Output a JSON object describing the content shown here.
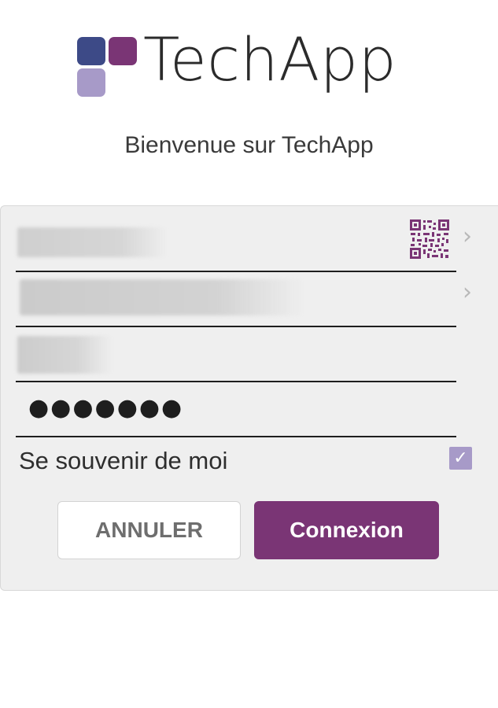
{
  "logo": {
    "text": "TechApp",
    "colors": [
      "#3d4a87",
      "#7a3575",
      "#a79ac8"
    ]
  },
  "welcome": "Bienvenue sur TechApp",
  "form": {
    "password_mask": "●●●●●●●",
    "remember_label": "Se souvenir de moi",
    "remember_checked": true,
    "checkbox_glyph": "✓",
    "chevron_glyph": "›",
    "qr_icon": "qr-code-icon"
  },
  "buttons": {
    "cancel": "ANNULER",
    "login": "Connexion"
  },
  "colors": {
    "accent": "#7a3575",
    "panel": "#efefef",
    "checkbox": "#a79ac8"
  }
}
